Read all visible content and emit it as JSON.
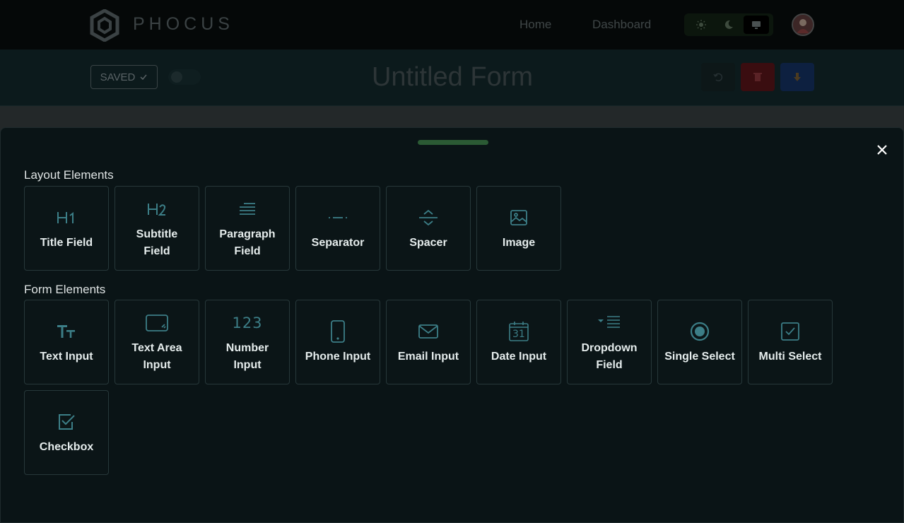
{
  "nav": {
    "brand": "PHOCUS",
    "home": "Home",
    "dashboard": "Dashboard",
    "theme_options": [
      "light-icon",
      "dark-icon",
      "system-icon"
    ],
    "theme_selected": "system"
  },
  "toolbar": {
    "saved": "SAVED",
    "form_title": "Untitled Form"
  },
  "drawer": {
    "layout_title": "Layout Elements",
    "form_title": "Form Elements",
    "layout_items": [
      {
        "label": "Title Field",
        "icon": "heading-1-icon"
      },
      {
        "label": "Subtitle Field",
        "icon": "heading-2-icon"
      },
      {
        "label": "Paragraph Field",
        "icon": "paragraph-icon"
      },
      {
        "label": "Separator",
        "icon": "separator-icon"
      },
      {
        "label": "Spacer",
        "icon": "spacer-icon"
      },
      {
        "label": "Image",
        "icon": "image-icon"
      }
    ],
    "form_items": [
      {
        "label": "Text Input",
        "icon": "text-input-icon"
      },
      {
        "label": "Text Area Input",
        "icon": "text-area-icon"
      },
      {
        "label": "Number Input",
        "icon": "number-icon",
        "glyph": "123"
      },
      {
        "label": "Phone Input",
        "icon": "phone-icon"
      },
      {
        "label": "Email Input",
        "icon": "email-icon"
      },
      {
        "label": "Date Input",
        "icon": "calendar-icon",
        "glyph": "31"
      },
      {
        "label": "Dropdown Field",
        "icon": "dropdown-icon"
      },
      {
        "label": "Single Select",
        "icon": "radio-icon"
      },
      {
        "label": "Multi Select",
        "icon": "multi-check-icon"
      },
      {
        "label": "Checkbox",
        "icon": "checkbox-icon"
      }
    ]
  },
  "colors": {
    "accent": "#3c7e87",
    "handle": "#2b5a34",
    "delete": "#3a0d10",
    "save": "#0d2040"
  }
}
